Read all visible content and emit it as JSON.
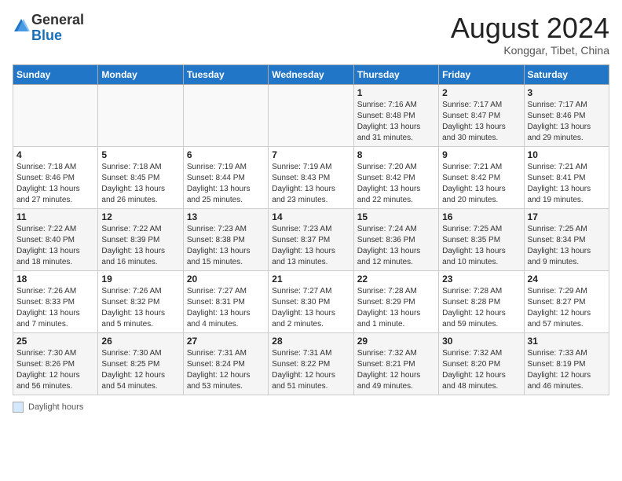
{
  "header": {
    "logo_general": "General",
    "logo_blue": "Blue",
    "month_year": "August 2024",
    "location": "Konggar, Tibet, China"
  },
  "legend": {
    "box_label": "Daylight hours"
  },
  "weekdays": [
    "Sunday",
    "Monday",
    "Tuesday",
    "Wednesday",
    "Thursday",
    "Friday",
    "Saturday"
  ],
  "weeks": [
    [
      {
        "num": "",
        "detail": ""
      },
      {
        "num": "",
        "detail": ""
      },
      {
        "num": "",
        "detail": ""
      },
      {
        "num": "",
        "detail": ""
      },
      {
        "num": "1",
        "detail": "Sunrise: 7:16 AM\nSunset: 8:48 PM\nDaylight: 13 hours\nand 31 minutes."
      },
      {
        "num": "2",
        "detail": "Sunrise: 7:17 AM\nSunset: 8:47 PM\nDaylight: 13 hours\nand 30 minutes."
      },
      {
        "num": "3",
        "detail": "Sunrise: 7:17 AM\nSunset: 8:46 PM\nDaylight: 13 hours\nand 29 minutes."
      }
    ],
    [
      {
        "num": "4",
        "detail": "Sunrise: 7:18 AM\nSunset: 8:46 PM\nDaylight: 13 hours\nand 27 minutes."
      },
      {
        "num": "5",
        "detail": "Sunrise: 7:18 AM\nSunset: 8:45 PM\nDaylight: 13 hours\nand 26 minutes."
      },
      {
        "num": "6",
        "detail": "Sunrise: 7:19 AM\nSunset: 8:44 PM\nDaylight: 13 hours\nand 25 minutes."
      },
      {
        "num": "7",
        "detail": "Sunrise: 7:19 AM\nSunset: 8:43 PM\nDaylight: 13 hours\nand 23 minutes."
      },
      {
        "num": "8",
        "detail": "Sunrise: 7:20 AM\nSunset: 8:42 PM\nDaylight: 13 hours\nand 22 minutes."
      },
      {
        "num": "9",
        "detail": "Sunrise: 7:21 AM\nSunset: 8:42 PM\nDaylight: 13 hours\nand 20 minutes."
      },
      {
        "num": "10",
        "detail": "Sunrise: 7:21 AM\nSunset: 8:41 PM\nDaylight: 13 hours\nand 19 minutes."
      }
    ],
    [
      {
        "num": "11",
        "detail": "Sunrise: 7:22 AM\nSunset: 8:40 PM\nDaylight: 13 hours\nand 18 minutes."
      },
      {
        "num": "12",
        "detail": "Sunrise: 7:22 AM\nSunset: 8:39 PM\nDaylight: 13 hours\nand 16 minutes."
      },
      {
        "num": "13",
        "detail": "Sunrise: 7:23 AM\nSunset: 8:38 PM\nDaylight: 13 hours\nand 15 minutes."
      },
      {
        "num": "14",
        "detail": "Sunrise: 7:23 AM\nSunset: 8:37 PM\nDaylight: 13 hours\nand 13 minutes."
      },
      {
        "num": "15",
        "detail": "Sunrise: 7:24 AM\nSunset: 8:36 PM\nDaylight: 13 hours\nand 12 minutes."
      },
      {
        "num": "16",
        "detail": "Sunrise: 7:25 AM\nSunset: 8:35 PM\nDaylight: 13 hours\nand 10 minutes."
      },
      {
        "num": "17",
        "detail": "Sunrise: 7:25 AM\nSunset: 8:34 PM\nDaylight: 13 hours\nand 9 minutes."
      }
    ],
    [
      {
        "num": "18",
        "detail": "Sunrise: 7:26 AM\nSunset: 8:33 PM\nDaylight: 13 hours\nand 7 minutes."
      },
      {
        "num": "19",
        "detail": "Sunrise: 7:26 AM\nSunset: 8:32 PM\nDaylight: 13 hours\nand 5 minutes."
      },
      {
        "num": "20",
        "detail": "Sunrise: 7:27 AM\nSunset: 8:31 PM\nDaylight: 13 hours\nand 4 minutes."
      },
      {
        "num": "21",
        "detail": "Sunrise: 7:27 AM\nSunset: 8:30 PM\nDaylight: 13 hours\nand 2 minutes."
      },
      {
        "num": "22",
        "detail": "Sunrise: 7:28 AM\nSunset: 8:29 PM\nDaylight: 13 hours\nand 1 minute."
      },
      {
        "num": "23",
        "detail": "Sunrise: 7:28 AM\nSunset: 8:28 PM\nDaylight: 12 hours\nand 59 minutes."
      },
      {
        "num": "24",
        "detail": "Sunrise: 7:29 AM\nSunset: 8:27 PM\nDaylight: 12 hours\nand 57 minutes."
      }
    ],
    [
      {
        "num": "25",
        "detail": "Sunrise: 7:30 AM\nSunset: 8:26 PM\nDaylight: 12 hours\nand 56 minutes."
      },
      {
        "num": "26",
        "detail": "Sunrise: 7:30 AM\nSunset: 8:25 PM\nDaylight: 12 hours\nand 54 minutes."
      },
      {
        "num": "27",
        "detail": "Sunrise: 7:31 AM\nSunset: 8:24 PM\nDaylight: 12 hours\nand 53 minutes."
      },
      {
        "num": "28",
        "detail": "Sunrise: 7:31 AM\nSunset: 8:22 PM\nDaylight: 12 hours\nand 51 minutes."
      },
      {
        "num": "29",
        "detail": "Sunrise: 7:32 AM\nSunset: 8:21 PM\nDaylight: 12 hours\nand 49 minutes."
      },
      {
        "num": "30",
        "detail": "Sunrise: 7:32 AM\nSunset: 8:20 PM\nDaylight: 12 hours\nand 48 minutes."
      },
      {
        "num": "31",
        "detail": "Sunrise: 7:33 AM\nSunset: 8:19 PM\nDaylight: 12 hours\nand 46 minutes."
      }
    ]
  ]
}
